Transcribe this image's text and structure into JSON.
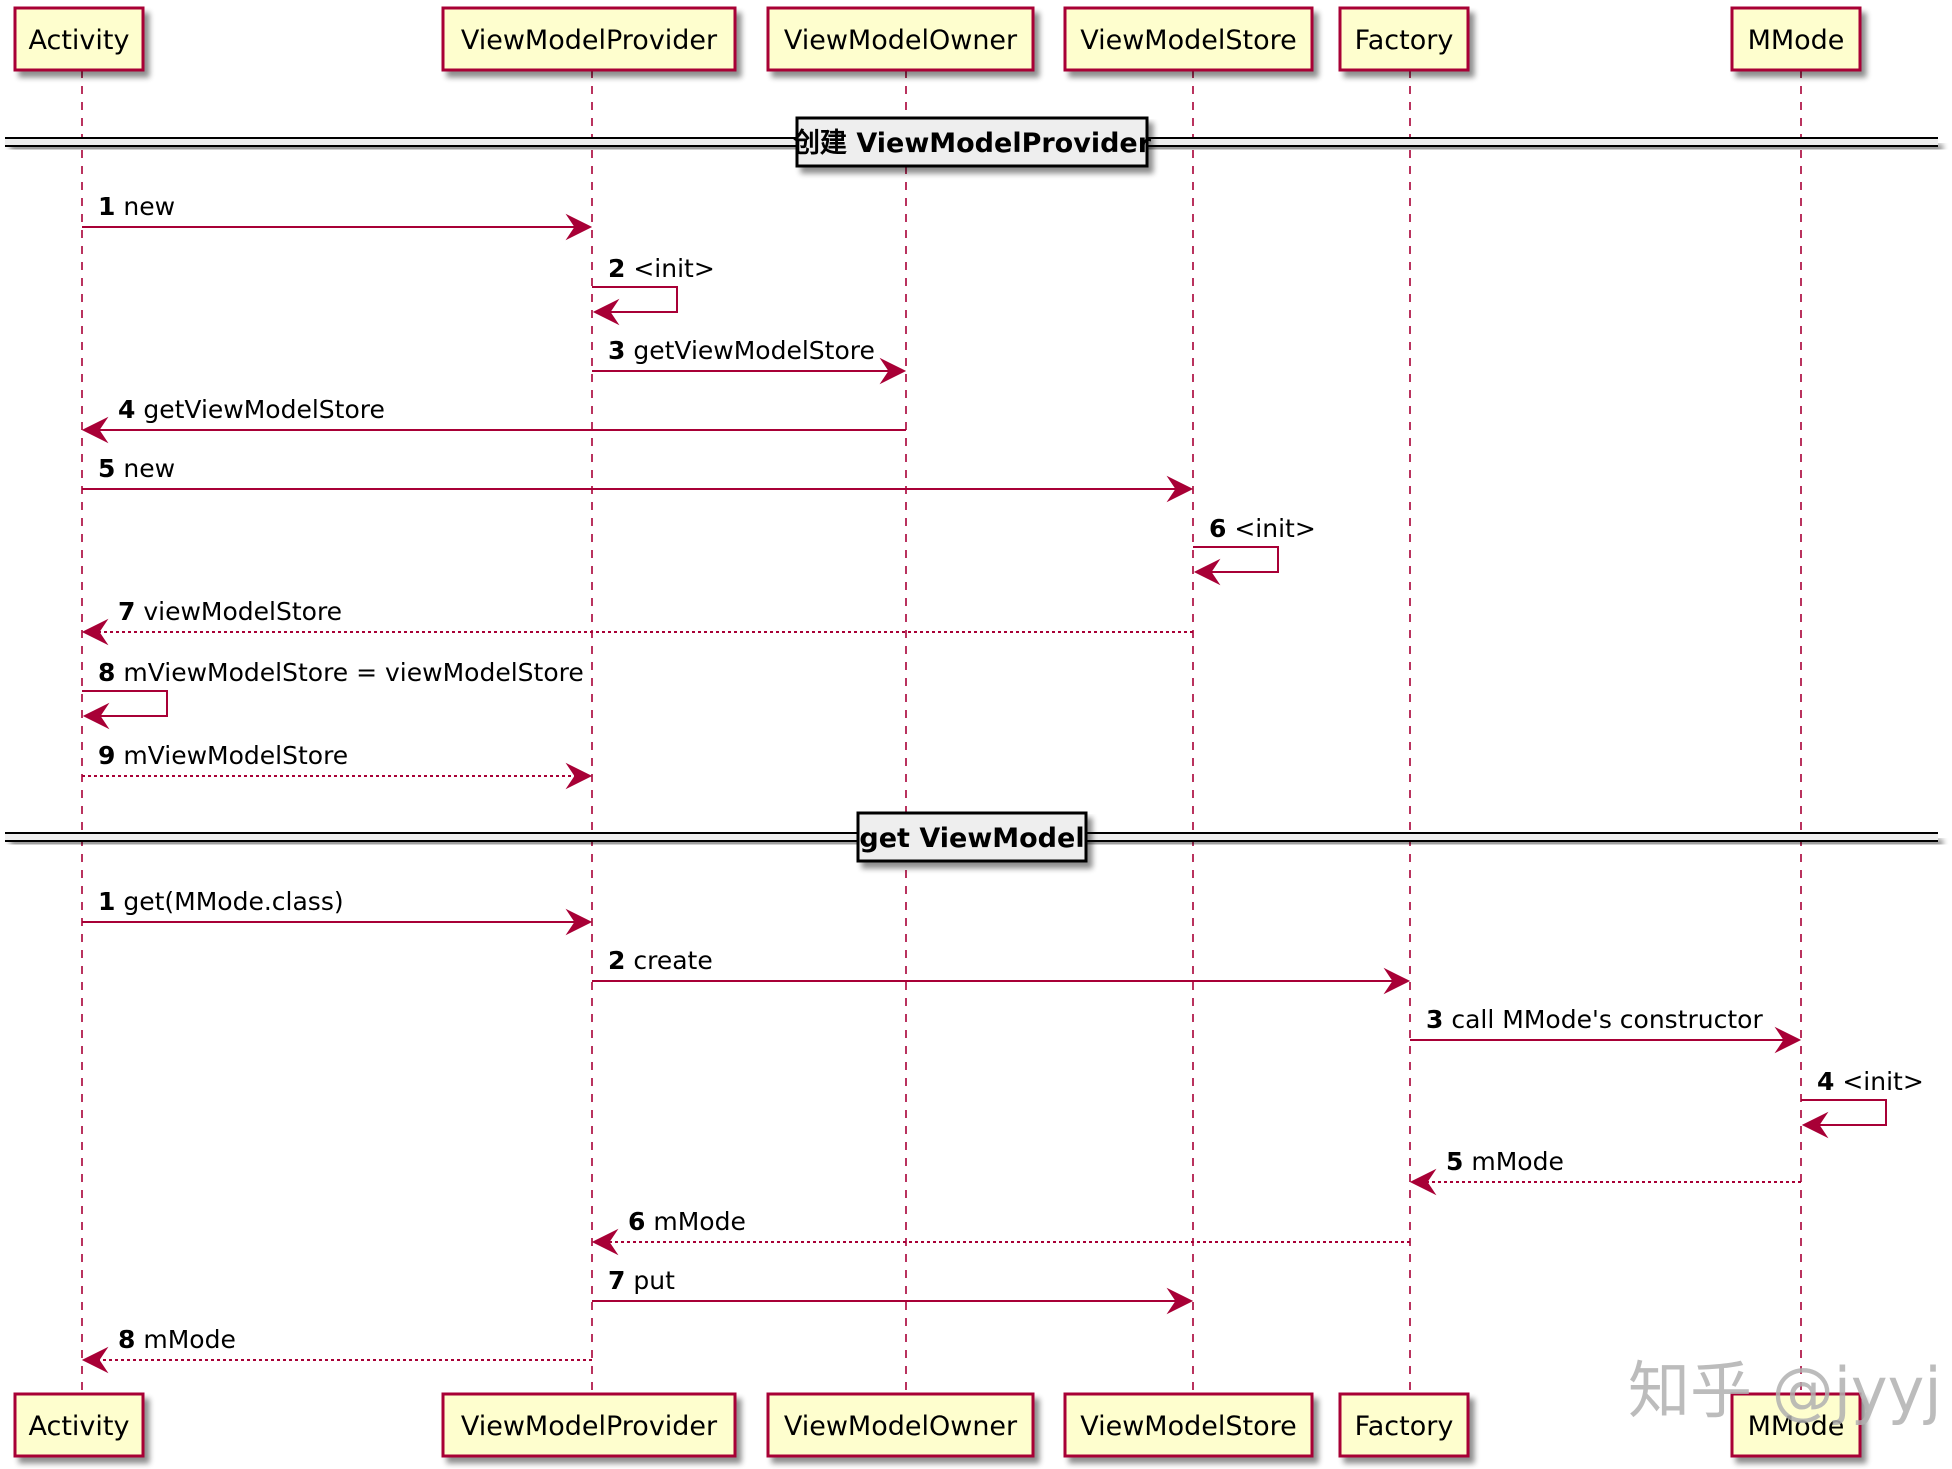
{
  "diagram": {
    "type": "sequence",
    "colors": {
      "line": "#A80036",
      "participant_fill": "#FEFECE",
      "participant_border": "#A80036",
      "divider_fill": "#EEEEEE",
      "divider_border": "#000000",
      "text": "#000000"
    },
    "participants": [
      {
        "id": "activity",
        "label": "Activity"
      },
      {
        "id": "provider",
        "label": "ViewModelProvider"
      },
      {
        "id": "owner",
        "label": "ViewModelOwner"
      },
      {
        "id": "store",
        "label": "ViewModelStore"
      },
      {
        "id": "factory",
        "label": "Factory"
      },
      {
        "id": "mmode",
        "label": "MMode"
      }
    ],
    "sections": [
      {
        "divider": "创建 ViewModelProvider",
        "messages": [
          {
            "num": "1",
            "text": "new",
            "from": "activity",
            "to": "provider",
            "style": "sync"
          },
          {
            "num": "2",
            "text": "<init>",
            "from": "provider",
            "to": "provider",
            "style": "sync"
          },
          {
            "num": "3",
            "text": "getViewModelStore",
            "from": "provider",
            "to": "owner",
            "style": "sync"
          },
          {
            "num": "4",
            "text": "getViewModelStore",
            "from": "owner",
            "to": "activity",
            "style": "sync"
          },
          {
            "num": "5",
            "text": "new",
            "from": "activity",
            "to": "store",
            "style": "sync"
          },
          {
            "num": "6",
            "text": "<init>",
            "from": "store",
            "to": "store",
            "style": "sync"
          },
          {
            "num": "7",
            "text": "viewModelStore",
            "from": "store",
            "to": "activity",
            "style": "return"
          },
          {
            "num": "8",
            "text": "mViewModelStore = viewModelStore",
            "from": "activity",
            "to": "activity",
            "style": "sync"
          },
          {
            "num": "9",
            "text": "mViewModelStore",
            "from": "activity",
            "to": "provider",
            "style": "return"
          }
        ]
      },
      {
        "divider": "get ViewModel",
        "messages": [
          {
            "num": "1",
            "text": "get(MMode.class)",
            "from": "activity",
            "to": "provider",
            "style": "sync"
          },
          {
            "num": "2",
            "text": "create",
            "from": "provider",
            "to": "factory",
            "style": "sync"
          },
          {
            "num": "3",
            "text": "call MMode's constructor",
            "from": "factory",
            "to": "mmode",
            "style": "sync"
          },
          {
            "num": "4",
            "text": "<init>",
            "from": "mmode",
            "to": "mmode",
            "style": "sync"
          },
          {
            "num": "5",
            "text": "mMode",
            "from": "mmode",
            "to": "factory",
            "style": "return"
          },
          {
            "num": "6",
            "text": "mMode",
            "from": "factory",
            "to": "provider",
            "style": "return"
          },
          {
            "num": "7",
            "text": "put",
            "from": "provider",
            "to": "store",
            "style": "sync"
          },
          {
            "num": "8",
            "text": "mMode",
            "from": "provider",
            "to": "activity",
            "style": "return"
          }
        ]
      }
    ]
  },
  "watermark": "知乎 @jyyj"
}
